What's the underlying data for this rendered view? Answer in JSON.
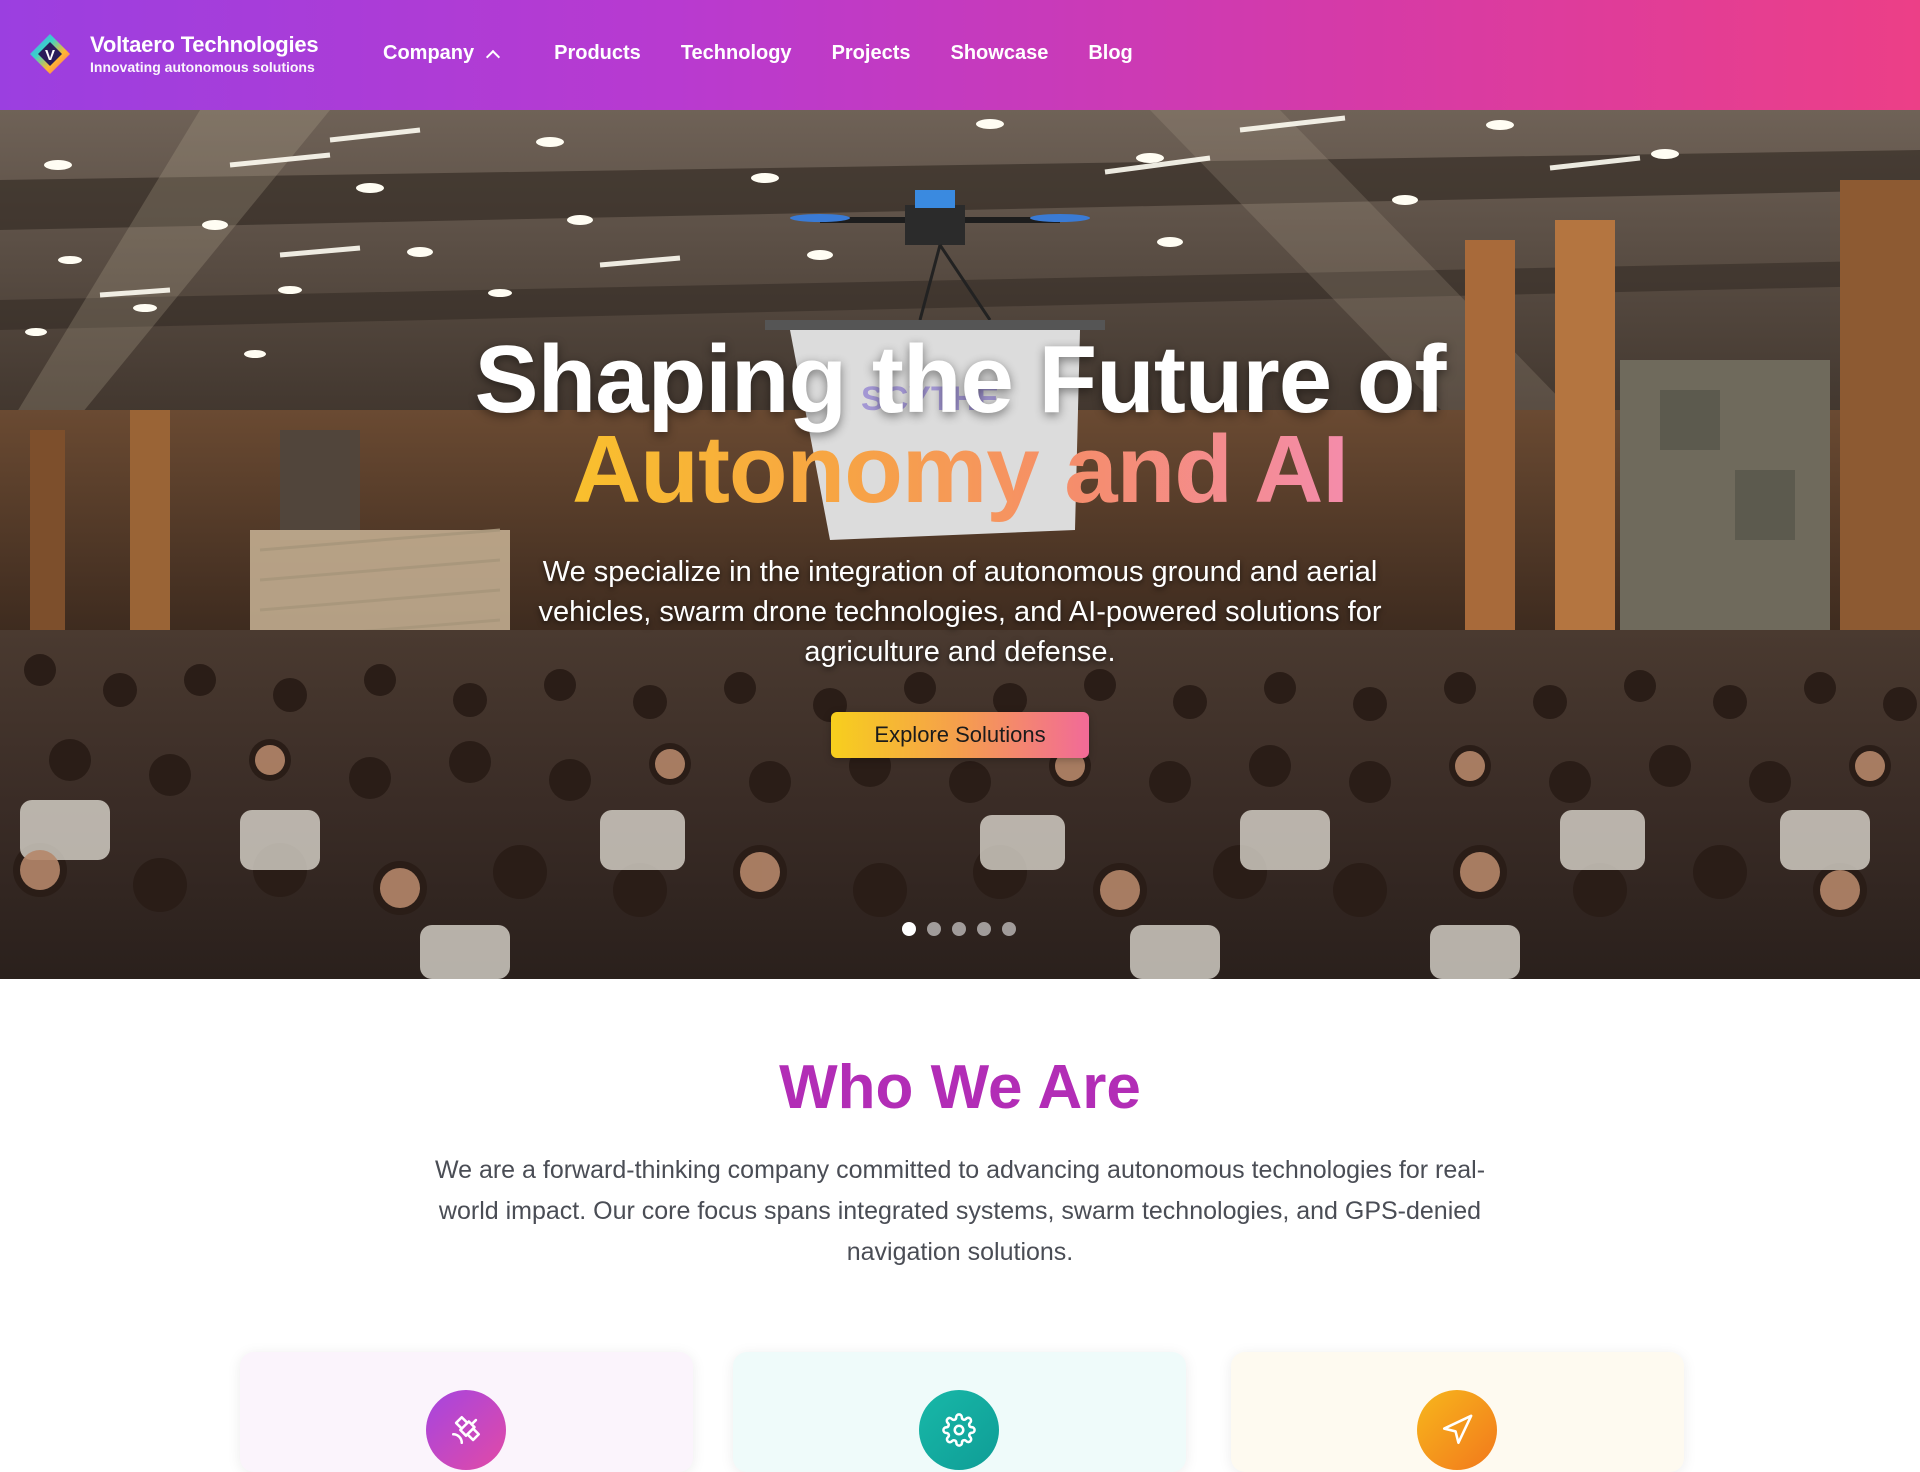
{
  "brand": {
    "name": "Voltaero Technologies",
    "tagline": "Innovating autonomous solutions",
    "logo_letter": "V"
  },
  "nav": {
    "items": [
      {
        "label": "Company",
        "has_dropdown": true
      },
      {
        "label": "Products"
      },
      {
        "label": "Technology"
      },
      {
        "label": "Projects"
      },
      {
        "label": "Showcase"
      },
      {
        "label": "Blog"
      }
    ]
  },
  "hero": {
    "title_line1": "Shaping the Future of",
    "title_line2": "Autonomy and AI",
    "subtitle": "We specialize in the integration of autonomous ground and aerial vehicles, swarm drone technologies, and AI-powered solutions for agriculture and defense.",
    "cta_label": "Explore Solutions",
    "slide_count": 5,
    "active_slide": 1
  },
  "who": {
    "title": "Who We Are",
    "text": "We are a forward-thinking company committed to advancing autonomous technologies for real-world impact. Our core focus spans integrated systems, swarm technologies, and GPS-denied navigation solutions."
  },
  "cards": [
    {
      "icon": "satellite-icon"
    },
    {
      "icon": "gear-icon"
    },
    {
      "icon": "navigation-icon"
    }
  ],
  "colors": {
    "nav_gradient_start": "#9b3fe0",
    "nav_gradient_end": "#ec3f87",
    "who_title": "#b22db6",
    "cta_start": "#f7cf1d",
    "cta_end": "#f26a98"
  }
}
